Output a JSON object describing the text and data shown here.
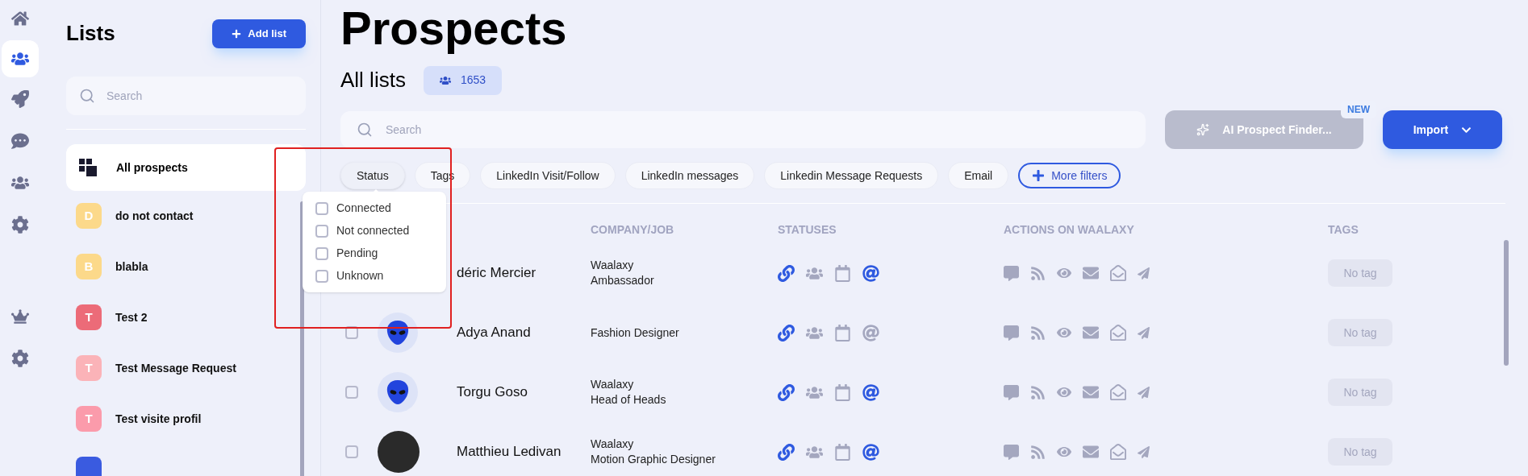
{
  "rail": [
    {
      "kind": "home",
      "selected": false
    },
    {
      "kind": "prospects",
      "selected": true
    },
    {
      "kind": "rocket",
      "selected": false
    },
    {
      "kind": "chat",
      "selected": false
    },
    {
      "kind": "team",
      "selected": false
    },
    {
      "kind": "settings",
      "selected": false
    },
    {
      "kind": "spacer"
    },
    {
      "kind": "crown",
      "selected": false
    },
    {
      "kind": "settings",
      "selected": false
    }
  ],
  "lists_panel": {
    "title": "Lists",
    "add_button": "Add list",
    "search": {
      "placeholder": "Search"
    },
    "all_item": {
      "label": "All prospects",
      "selected": true
    },
    "items": [
      {
        "letter": "D",
        "name": "do not contact",
        "color": "#fcd98a"
      },
      {
        "letter": "B",
        "name": "blabla",
        "color": "#fcd98a"
      },
      {
        "letter": "T",
        "name": "Test 2",
        "color": "#ec6b78"
      },
      {
        "letter": "T",
        "name": "Test Message Request",
        "color": "#fbb3b8"
      },
      {
        "letter": "T",
        "name": "Test visite profil",
        "color": "#fb9bab"
      },
      {
        "color": "#3a5be0"
      }
    ]
  },
  "main": {
    "title": "Prospects",
    "subtitle": "All lists",
    "count": "1653",
    "search": {
      "placeholder": "Search"
    },
    "ai_button": {
      "label": "AI Prospect Finder...",
      "badge": "NEW",
      "disabled": true
    },
    "import_button": "Import",
    "filters": [
      {
        "label": "Status",
        "open": true
      },
      {
        "label": "Tags",
        "open": false
      },
      {
        "label": "LinkedIn Visit/Follow",
        "open": false
      },
      {
        "label": "LinkedIn messages",
        "open": false
      },
      {
        "label": "Linkedin Message Requests",
        "open": false
      },
      {
        "label": "Email",
        "open": false
      }
    ],
    "more_filters": "More filters",
    "status_menu": [
      {
        "label": "Connected",
        "checked": false
      },
      {
        "label": "Not connected",
        "checked": false
      },
      {
        "label": "Pending",
        "checked": false
      },
      {
        "label": "Unknown",
        "checked": false
      }
    ],
    "table": {
      "columns": [
        "COMPANY/JOB",
        "STATUSES",
        "ACTIONS ON WAALAXY",
        "TAGS"
      ],
      "rows": [
        {
          "kind": "covered",
          "name": "déric Mercier",
          "company": "Waalaxy",
          "job": "Ambassador",
          "statuses": [
            {
              "kind": "link",
              "on": true
            },
            {
              "kind": "group",
              "on": false
            },
            {
              "kind": "calendar",
              "on": false
            },
            {
              "kind": "email",
              "on": true
            }
          ],
          "tag": "No tag"
        },
        {
          "kind": "alien",
          "name": "Adya Anand",
          "job": "Fashion Designer",
          "checked": false,
          "statuses": [
            {
              "kind": "link",
              "on": true
            },
            {
              "kind": "group",
              "on": false
            },
            {
              "kind": "calendar",
              "on": false
            },
            {
              "kind": "email",
              "on": false
            }
          ],
          "tag": "No tag"
        },
        {
          "kind": "alien",
          "name": "Torgu Goso",
          "company": "Waalaxy",
          "job": "Head of Heads",
          "checked": false,
          "statuses": [
            {
              "kind": "link",
              "on": true
            },
            {
              "kind": "group",
              "on": false
            },
            {
              "kind": "calendar",
              "on": false
            },
            {
              "kind": "email",
              "on": true
            }
          ],
          "tag": "No tag"
        },
        {
          "kind": "photo",
          "name": "Matthieu Ledivan",
          "company": "Waalaxy",
          "job": "Motion Graphic Designer",
          "checked": false,
          "statuses": [
            {
              "kind": "link",
              "on": true
            },
            {
              "kind": "group",
              "on": false
            },
            {
              "kind": "calendar",
              "on": false
            },
            {
              "kind": "email",
              "on": true
            }
          ],
          "tag": "No tag"
        }
      ]
    }
  }
}
